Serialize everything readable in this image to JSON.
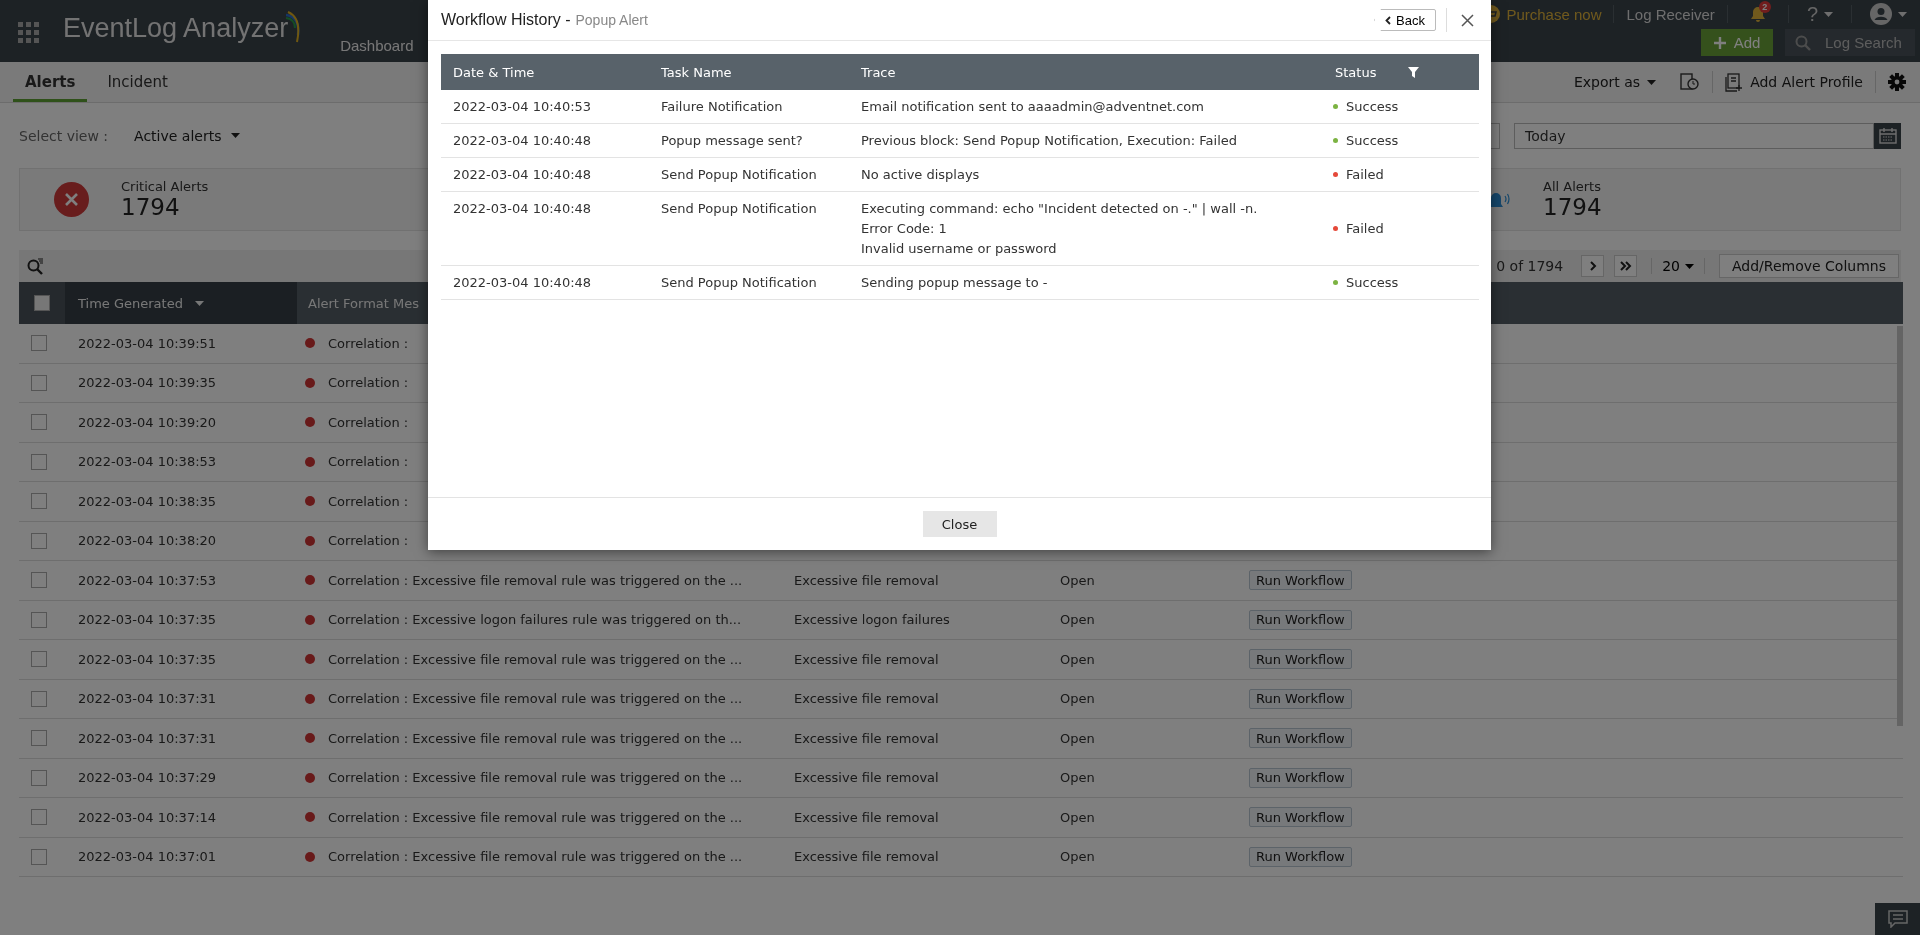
{
  "header": {
    "app_name": "EventLog Analyzer",
    "nav": [
      "Dashboard"
    ],
    "purchase": "Purchase now",
    "log_receiver": "Log Receiver",
    "notification_count": "2",
    "help": "?",
    "add_button": "Add",
    "search_placeholder": "Log Search"
  },
  "tabs": [
    {
      "label": "Alerts",
      "selected": true
    },
    {
      "label": "Incident",
      "selected": false
    }
  ],
  "actions": {
    "export": "Export as",
    "add_profile": "Add Alert Profile"
  },
  "view": {
    "label": "Select view :",
    "value": "Active alerts"
  },
  "date_range": "Today",
  "stats": [
    {
      "kind": "critical",
      "label": "Critical Alerts",
      "count": "1794"
    },
    {
      "kind": "all",
      "label": "All Alerts",
      "count": "1794"
    }
  ],
  "pagination": {
    "range": "0 of 1794",
    "page_size": "20",
    "columns_button": "Add/Remove Columns"
  },
  "alerts_table": {
    "select_all_checked": false,
    "columns": [
      "Time Generated",
      "Alert Format Mes"
    ],
    "rows": [
      {
        "checked": false,
        "time": "2022-03-04 10:39:51",
        "message": "Correlation :"
      },
      {
        "checked": false,
        "time": "2022-03-04 10:39:35",
        "message": "Correlation :"
      },
      {
        "checked": false,
        "time": "2022-03-04 10:39:20",
        "message": "Correlation :"
      },
      {
        "checked": false,
        "time": "2022-03-04 10:38:53",
        "message": "Correlation :"
      },
      {
        "checked": false,
        "time": "2022-03-04 10:38:35",
        "message": "Correlation :"
      },
      {
        "checked": false,
        "time": "2022-03-04 10:38:20",
        "message": "Correlation :"
      },
      {
        "checked": false,
        "time": "2022-03-04 10:37:53",
        "message": "Correlation : Excessive file removal rule was triggered on the ...",
        "type": "Excessive file removal",
        "status": "Open",
        "action": "Run Workflow"
      },
      {
        "checked": false,
        "time": "2022-03-04 10:37:35",
        "message": "Correlation : Excessive logon failures rule was triggered on th...",
        "type": "Excessive logon failures",
        "status": "Open",
        "action": "Run Workflow"
      },
      {
        "checked": false,
        "time": "2022-03-04 10:37:35",
        "message": "Correlation : Excessive file removal rule was triggered on the ...",
        "type": "Excessive file removal",
        "status": "Open",
        "action": "Run Workflow"
      },
      {
        "checked": false,
        "time": "2022-03-04 10:37:31",
        "message": "Correlation : Excessive file removal rule was triggered on the ...",
        "type": "Excessive file removal",
        "status": "Open",
        "action": "Run Workflow"
      },
      {
        "checked": false,
        "time": "2022-03-04 10:37:31",
        "message": "Correlation : Excessive file removal rule was triggered on the ...",
        "type": "Excessive file removal",
        "status": "Open",
        "action": "Run Workflow"
      },
      {
        "checked": false,
        "time": "2022-03-04 10:37:29",
        "message": "Correlation : Excessive file removal rule was triggered on the ...",
        "type": "Excessive file removal",
        "status": "Open",
        "action": "Run Workflow"
      },
      {
        "checked": false,
        "time": "2022-03-04 10:37:14",
        "message": "Correlation : Excessive file removal rule was triggered on the ...",
        "type": "Excessive file removal",
        "status": "Open",
        "action": "Run Workflow"
      },
      {
        "checked": false,
        "time": "2022-03-04 10:37:01",
        "message": "Correlation : Excessive file removal rule was triggered on the ...",
        "type": "Excessive file removal",
        "status": "Open",
        "action": "Run Workflow"
      }
    ]
  },
  "modal": {
    "title": "Workflow History -",
    "subtitle": "Popup Alert",
    "back_button": "Back",
    "columns": [
      "Date & Time",
      "Task Name",
      "Trace",
      "Status"
    ],
    "rows": [
      {
        "time": "2022-03-04 10:40:53",
        "task": "Failure Notification",
        "trace": [
          "Email notification sent to aaaadmin@adventnet.com"
        ],
        "status": "Success",
        "color": "#7cb342"
      },
      {
        "time": "2022-03-04 10:40:48",
        "task": "Popup message sent?",
        "trace": [
          "Previous block: Send Popup Notification, Execution: Failed"
        ],
        "status": "Success",
        "color": "#7cb342"
      },
      {
        "time": "2022-03-04 10:40:48",
        "task": "Send Popup Notification",
        "trace": [
          "No active displays"
        ],
        "status": "Failed",
        "color": "#e5493a"
      },
      {
        "time": "2022-03-04 10:40:48",
        "task": "Send Popup Notification",
        "trace": [
          "Executing command: echo \"Incident detected on -.\" | wall -n.",
          "Error Code: 1",
          "Invalid username or password"
        ],
        "status": "Failed",
        "color": "#e5493a"
      },
      {
        "time": "2022-03-04 10:40:48",
        "task": "Send Popup Notification",
        "trace": [
          "Sending popup message to -"
        ],
        "status": "Success",
        "color": "#7cb342"
      }
    ],
    "close_button": "Close"
  }
}
